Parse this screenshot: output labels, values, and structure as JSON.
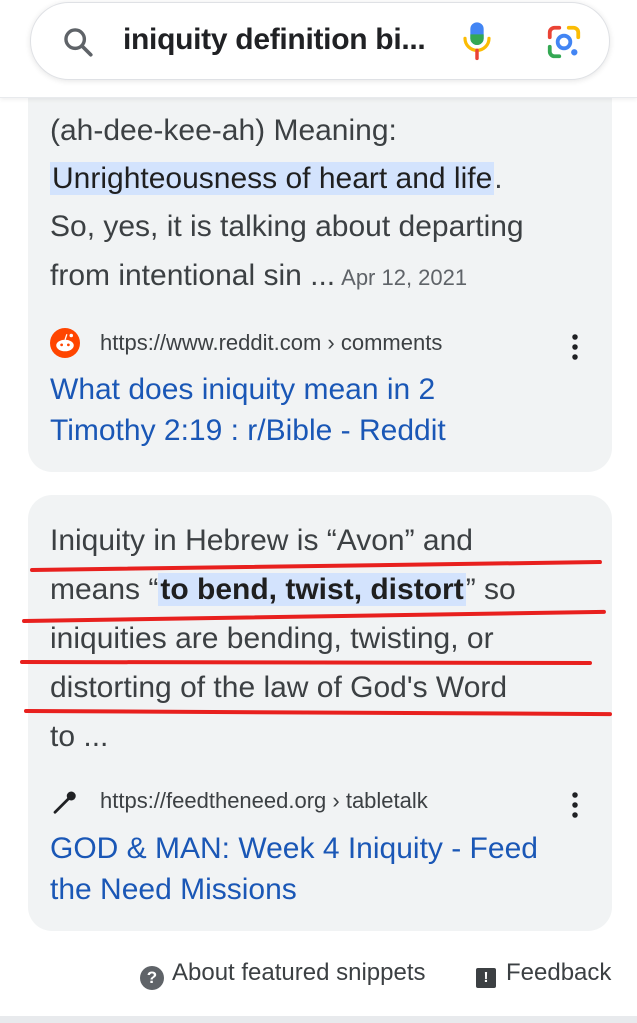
{
  "search": {
    "query": "iniquity definition bi..."
  },
  "result1": {
    "snippet_line1": "(ah-dee-kee-ah) Meaning:",
    "snippet_highlight": "Unrighteousness of heart and life",
    "snippet_highlight_after": ".",
    "snippet_line3": "So, yes, it is talking about departing",
    "snippet_line4": "from intentional sin ...",
    "date": "Apr 12, 2021",
    "source_url": "https://www.reddit.com › comments",
    "title_line1": "What does iniquity mean in 2",
    "title_line2": "Timothy 2:19 : r/Bible - Reddit"
  },
  "result2": {
    "line1": "Iniquity in Hebrew is “Avon” and",
    "line2_before": "means “",
    "line2_highlight": "to bend, twist, distort",
    "line2_after": "” so",
    "line3": "iniquities are bending, twisting, or",
    "line4": "distorting of the law of God's Word",
    "line5": "to ...",
    "source_url": "https://feedtheneed.org › tabletalk",
    "title_line1": "GOD & MAN: Week 4 Iniquity - Feed",
    "title_line2": "the Need Missions"
  },
  "footer": {
    "about": "About featured snippets",
    "feedback": "Feedback"
  },
  "colors": {
    "link": "#1a57b6",
    "highlight": "#d3e3fd",
    "annotation_red": "#e8201e",
    "card_bg": "#f1f3f4"
  }
}
